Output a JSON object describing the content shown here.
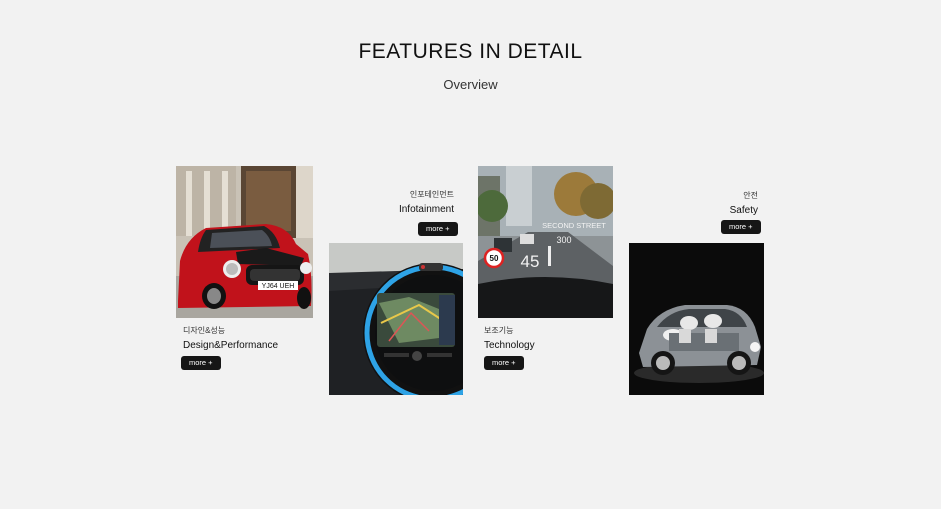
{
  "section": {
    "title": "FEATURES IN DETAIL",
    "subtitle": "Overview"
  },
  "cards": [
    {
      "label_ko": "디자인&성능",
      "label_en": "Design&Performance",
      "more": "more +",
      "image": "red-mini-hatch"
    },
    {
      "label_ko": "인포테인먼트",
      "label_en": "Infotainment",
      "more": "more +",
      "image": "navigation-display"
    },
    {
      "label_ko": "보조기능",
      "label_en": "Technology",
      "more": "more +",
      "image": "head-up-display",
      "hud": {
        "speed_limit": "50",
        "street": "SECOND STREET",
        "distance": "300",
        "speed": "45"
      }
    },
    {
      "label_ko": "안전",
      "label_en": "Safety",
      "more": "more +",
      "image": "safety-airbags-cutaway"
    }
  ],
  "car": {
    "plate": "YJ64 UEH"
  },
  "colors": {
    "background": "#f2f2f2",
    "button": "#161616",
    "accent_blue": "#2ea3e6"
  }
}
